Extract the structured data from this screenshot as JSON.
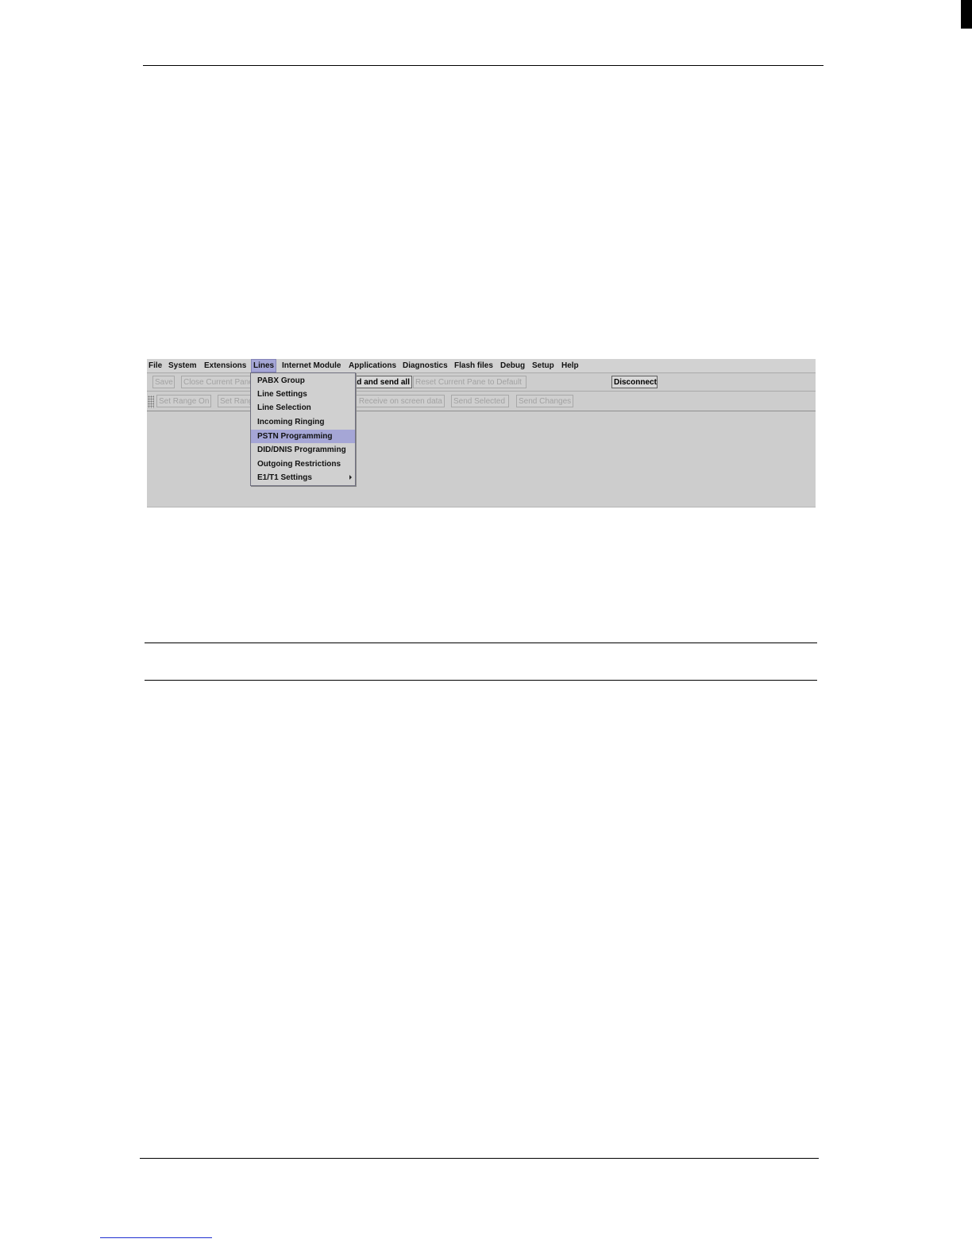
{
  "menubar": {
    "items": [
      "File",
      "System",
      "Extensions",
      "Lines",
      "Internet Module",
      "Applications",
      "Diagnostics",
      "Flash files",
      "Debug",
      "Setup",
      "Help"
    ],
    "active": "Lines"
  },
  "toolbar1": {
    "save": "Save",
    "close_pane": "Close Current Pane",
    "load_send_all": "Load and send all",
    "reset_pane": "Reset Current Pane to Default",
    "disconnect": "Disconnect"
  },
  "toolbar2": {
    "set_range_on": "Set Range On",
    "set_range_off": "Set Range Off",
    "receive_on_screen": "Receive on screen data",
    "send_selected": "Send Selected",
    "send_changes": "Send Changes"
  },
  "lines_menu": {
    "items": [
      "PABX Group",
      "Line Settings",
      "Line Selection",
      "Incoming Ringing",
      "PSTN Programming",
      "DID/DNIS Programming",
      "Outgoing Restrictions",
      "E1/T1 Settings"
    ],
    "selected": "PSTN Programming"
  }
}
